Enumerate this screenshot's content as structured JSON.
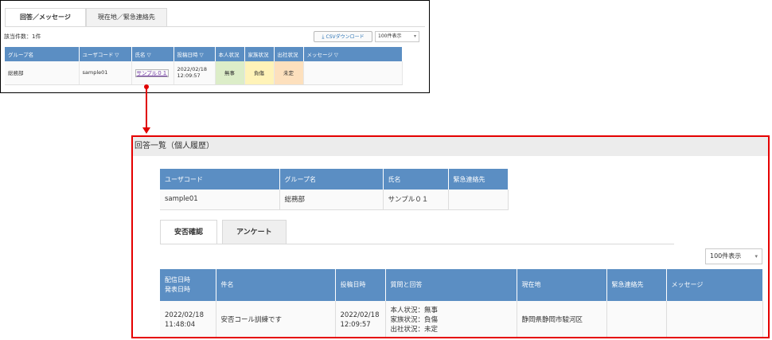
{
  "top": {
    "tabs": [
      "回答／メッセージ",
      "現在地／緊急連絡先"
    ],
    "count_text": "該当件数：1件",
    "csv_button": "CSVダウンロード",
    "page_size": "100件表示",
    "columns": [
      "グループ名",
      "ユーザコード ▽",
      "氏名 ▽",
      "投稿日時 ▽",
      "本人状況",
      "家族状況",
      "出社状況",
      "メッセージ ▽"
    ],
    "row": {
      "group": "総務部",
      "user_code": "sample01",
      "name": "サンプル０１",
      "posted_date": "2022/02/18",
      "posted_time": "12:09:57",
      "self_status": "無事",
      "family_status": "負傷",
      "office_status": "未定",
      "message": ""
    },
    "status_colors": {
      "self": "#dcedc8",
      "family": "#fff3b8",
      "office": "#fde0bd"
    }
  },
  "detail": {
    "title": "回答一覧（個人履歴）",
    "user_columns": [
      "ユーザコード",
      "グループ名",
      "氏名",
      "緊急連絡先"
    ],
    "user_row": {
      "user_code": "sample01",
      "group": "総務部",
      "name": "サンプル０１",
      "emergency": ""
    },
    "tabs": [
      "安否確認",
      "アンケート"
    ],
    "page_size": "100件表示",
    "resp_columns": {
      "delivered_1": "配信日時",
      "delivered_2": "発表日時",
      "subject": "件名",
      "posted": "投稿日時",
      "qa": "質問と回答",
      "location": "現在地",
      "emergency": "緊急連絡先",
      "message": "メッセージ"
    },
    "resp_row": {
      "delivered_date": "2022/02/18",
      "delivered_time": "11:48:04",
      "subject": "安否コール訓練です",
      "posted_date": "2022/02/18",
      "posted_time": "12:09:57",
      "answers": [
        "本人状況：無事",
        "家族状況：負傷",
        "出社状況：未定"
      ],
      "location": "静岡県静岡市駿河区",
      "emergency": "",
      "message": ""
    }
  },
  "colors": {
    "header_blue": "#5b8ec3",
    "highlight_red": "#e50000"
  }
}
